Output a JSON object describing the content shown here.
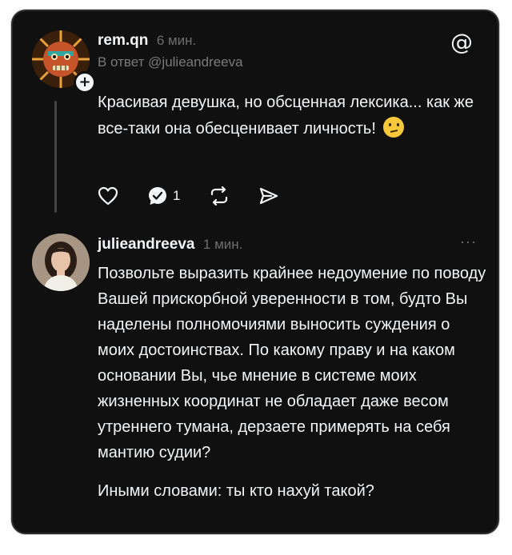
{
  "post1": {
    "username": "rem.qn",
    "time": "6 мин.",
    "reply_to": "В ответ @julieandreeva",
    "text": "Красивая девушка, но обсценная лексика... как же все-таки она обесценивает личность!",
    "emoji_icon": "confused-face-icon",
    "comment_count": "1"
  },
  "post2": {
    "username": "julieandreeva",
    "time": "1 мин.",
    "more": "···",
    "paragraph1": "Позвольте выразить крайнее недоумение по поводу Вашей прискорбной уверенности в том, будто Вы наделены полномочиями выносить суждения о моих достоинствах. По какому праву и на каком основании Вы, чье мнение в системе моих жизненных координат не обладает даже весом утреннего тумана, дерзаете примерять на себя мантию судии?",
    "paragraph2": "Иными словами: ты кто нахуй такой?"
  },
  "colors": {
    "background": "#101010",
    "text": "#f3f5f7",
    "muted": "#6f6f6f"
  }
}
